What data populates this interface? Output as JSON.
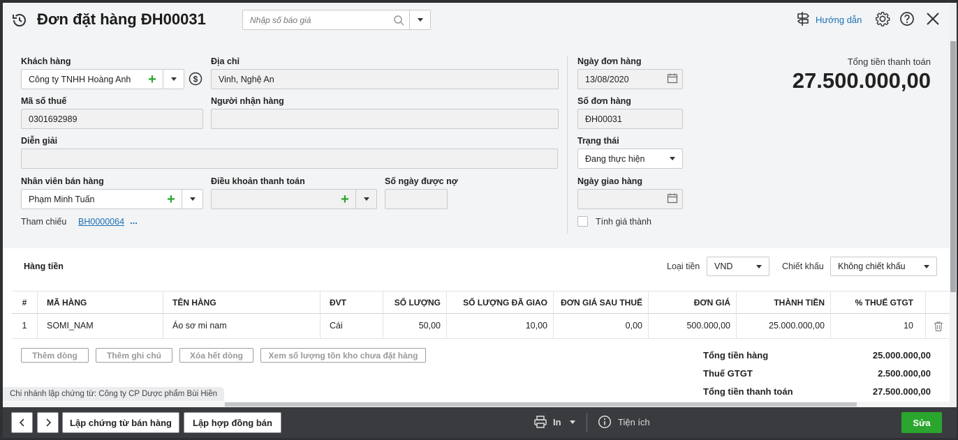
{
  "header": {
    "title": "Đơn đặt hàng ĐH00031",
    "quote_placeholder": "Nhập số báo giá",
    "guide_label": "Hướng dẫn"
  },
  "form": {
    "customer": {
      "label": "Khách hàng",
      "value": "Công ty TNHH Hoàng Anh"
    },
    "address": {
      "label": "Địa chỉ",
      "value": "Vinh, Nghệ An"
    },
    "tax_code": {
      "label": "Mã số thuế",
      "value": "0301692989"
    },
    "receiver": {
      "label": "Người nhận hàng",
      "value": ""
    },
    "description": {
      "label": "Diễn giải",
      "value": ""
    },
    "salesperson": {
      "label": "Nhân viên bán hàng",
      "value": "Phạm Minh Tuấn"
    },
    "payment_terms": {
      "label": "Điều khoản thanh toán",
      "value": ""
    },
    "credit_days": {
      "label": "Số ngày được nợ",
      "value": ""
    },
    "reference": {
      "label": "Tham chiếu",
      "value": "BH0000064",
      "more": "..."
    },
    "order_date": {
      "label": "Ngày đơn hàng",
      "value": "13/08/2020"
    },
    "order_no": {
      "label": "Số đơn hàng",
      "value": "ĐH00031"
    },
    "status": {
      "label": "Trạng thái",
      "value": "Đang thực hiện"
    },
    "delivery_date": {
      "label": "Ngày giao hàng",
      "value": ""
    },
    "calc_cost": {
      "label": "Tính giá thành"
    }
  },
  "total_top": {
    "label": "Tổng tiền thanh toán",
    "value": "27.500.000,00"
  },
  "goods": {
    "section_label": "Hàng tiền",
    "currency_label": "Loại tiền",
    "currency_value": "VND",
    "discount_label": "Chiết khấu",
    "discount_value": "Không chiết khấu"
  },
  "table": {
    "columns": [
      "#",
      "MÃ HÀNG",
      "TÊN HÀNG",
      "ĐVT",
      "SỐ LƯỢNG",
      "SỐ LƯỢNG ĐÃ GIAO",
      "ĐƠN GIÁ SAU THUẾ",
      "ĐƠN GIÁ",
      "THÀNH TIỀN",
      "% THUẾ GTGT"
    ],
    "rows": [
      {
        "no": "1",
        "code": "SOMI_NAM",
        "name": "Áo sơ mi nam",
        "unit": "Cái",
        "qty": "50,00",
        "delivered": "10,00",
        "price_after_tax": "0,00",
        "price": "500.000,00",
        "amount": "25.000.000,00",
        "vat": "10"
      }
    ]
  },
  "actions": {
    "add_row": "Thêm dòng",
    "add_note": "Thêm ghi chú",
    "delete_all": "Xóa hết dòng",
    "view_stock": "Xem số lượng tồn kho chưa đặt hàng"
  },
  "summary": {
    "goods_total_label": "Tổng tiền hàng",
    "goods_total": "25.000.000,00",
    "vat_label": "Thuế GTGT",
    "vat": "2.500.000,00",
    "pay_total_label": "Tổng tiền thanh toán",
    "pay_total": "27.500.000,00"
  },
  "branch": "Chi nhánh lập chứng từ: Công ty CP Dược phẩm Bùi Hiền",
  "footer": {
    "sales_voucher": "Lập chứng từ bán hàng",
    "sales_contract": "Lập hợp đồng bán",
    "print": "In",
    "utilities": "Tiện ích",
    "edit": "Sửa"
  },
  "colors": {
    "accent_green": "#2aa52e",
    "link_blue": "#1a6fb5",
    "footer_bg": "#3a3b3f"
  }
}
